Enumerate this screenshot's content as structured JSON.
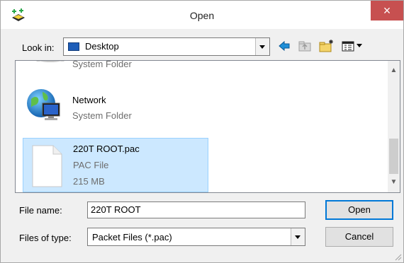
{
  "window": {
    "title": "Open",
    "close_icon": "×"
  },
  "toolbar": {
    "look_in_label": "Look in:",
    "location": "Desktop",
    "icons": [
      "back-icon",
      "up-folder-icon",
      "new-folder-icon",
      "view-menu-icon"
    ]
  },
  "files": [
    {
      "name": "",
      "type": "System Folder",
      "size": "",
      "icon": "computer-icon",
      "selected": false
    },
    {
      "name": "Network",
      "type": "System Folder",
      "size": "",
      "icon": "network-icon",
      "selected": false
    },
    {
      "name": "220T ROOT.pac",
      "type": "PAC File",
      "size": "215 MB",
      "icon": "document-icon",
      "selected": true
    }
  ],
  "form": {
    "file_name_label": "File name:",
    "file_name_value": "220T ROOT",
    "file_type_label": "Files of type:",
    "file_type_value": "Packet Files (*.pac)"
  },
  "buttons": {
    "open": "Open",
    "cancel": "Cancel"
  },
  "colors": {
    "selection_bg": "#cce8ff",
    "selection_border": "#99d1ff",
    "close_bg": "#c75050",
    "default_button_border": "#0078d7"
  }
}
